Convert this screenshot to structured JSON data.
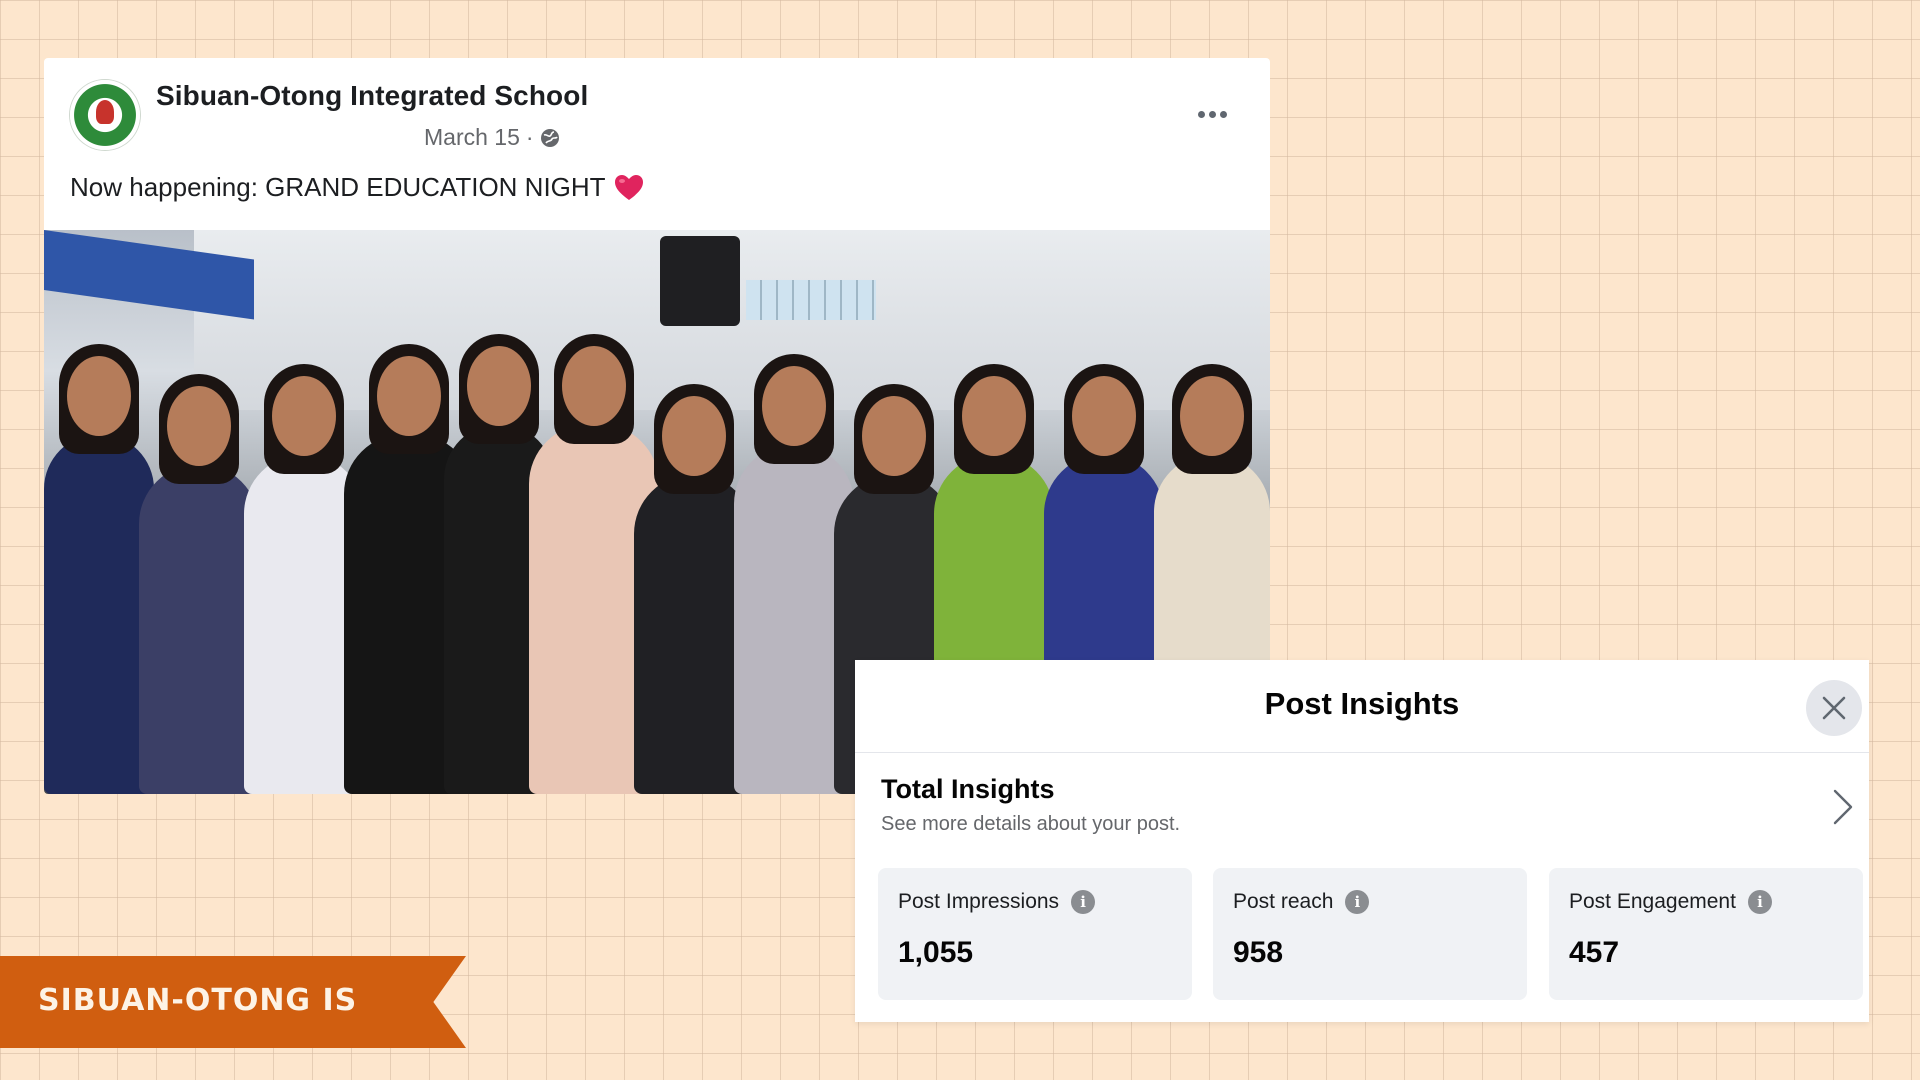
{
  "post": {
    "page_name": "Sibuan-Otong Integrated School",
    "date": "March 15",
    "separator": "·",
    "audience_icon": "globe-icon",
    "more_icon": "more-options-icon",
    "text": "Now happening: GRAND EDUCATION NIGHT",
    "emoji": "heart-icon",
    "photo_caption": ""
  },
  "insights": {
    "title": "Post Insights",
    "close_icon": "close-icon",
    "total_insights": {
      "title": "Total Insights",
      "subtitle": "See more details about your post."
    },
    "metrics": [
      {
        "label": "Post Impressions",
        "value": "1,055"
      },
      {
        "label": "Post reach",
        "value": "958"
      },
      {
        "label": "Post Engagement",
        "value": "457"
      }
    ]
  },
  "banner": {
    "text": "SIBUAN-OTONG IS"
  },
  "colors": {
    "background": "#fde6cd",
    "banner": "#d05e10",
    "card_bg": "#f0f2f5",
    "heart": "#e0245e"
  }
}
